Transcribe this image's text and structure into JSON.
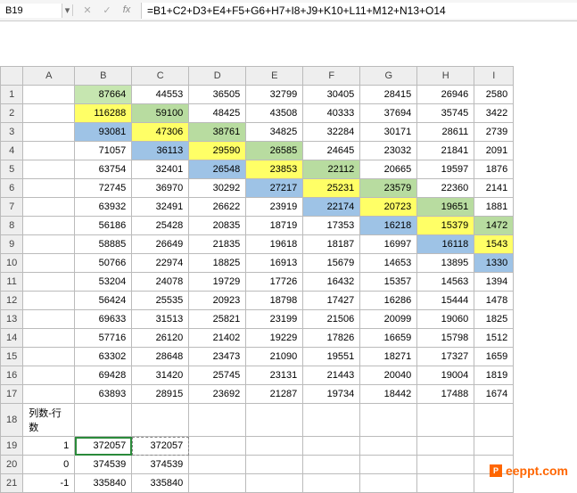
{
  "name_box": "B19",
  "formula": "=B1+C2+D3+E4+F5+G6+H7+I8+J9+K10+L11+M12+N13+O14",
  "cols": [
    "",
    "A",
    "B",
    "C",
    "D",
    "E",
    "F",
    "G",
    "H",
    "I"
  ],
  "rows": [
    {
      "r": "1",
      "cells": [
        {
          "v": ""
        },
        {
          "v": "87664",
          "c": "hl-g1"
        },
        {
          "v": "44553"
        },
        {
          "v": "36505"
        },
        {
          "v": "32799"
        },
        {
          "v": "30405"
        },
        {
          "v": "28415"
        },
        {
          "v": "26946"
        },
        {
          "v": "2580"
        }
      ]
    },
    {
      "r": "2",
      "cells": [
        {
          "v": ""
        },
        {
          "v": "116288",
          "c": "hl-y"
        },
        {
          "v": "59100",
          "c": "hl-g2"
        },
        {
          "v": "48425"
        },
        {
          "v": "43508"
        },
        {
          "v": "40333"
        },
        {
          "v": "37694"
        },
        {
          "v": "35745"
        },
        {
          "v": "3422"
        }
      ]
    },
    {
      "r": "3",
      "cells": [
        {
          "v": ""
        },
        {
          "v": "93081",
          "c": "hl-b"
        },
        {
          "v": "47306",
          "c": "hl-y"
        },
        {
          "v": "38761",
          "c": "hl-g2"
        },
        {
          "v": "34825"
        },
        {
          "v": "32284"
        },
        {
          "v": "30171"
        },
        {
          "v": "28611"
        },
        {
          "v": "2739"
        }
      ]
    },
    {
      "r": "4",
      "cells": [
        {
          "v": ""
        },
        {
          "v": "71057"
        },
        {
          "v": "36113",
          "c": "hl-b"
        },
        {
          "v": "29590",
          "c": "hl-y"
        },
        {
          "v": "26585",
          "c": "hl-g2"
        },
        {
          "v": "24645"
        },
        {
          "v": "23032"
        },
        {
          "v": "21841"
        },
        {
          "v": "2091"
        }
      ]
    },
    {
      "r": "5",
      "cells": [
        {
          "v": ""
        },
        {
          "v": "63754"
        },
        {
          "v": "32401"
        },
        {
          "v": "26548",
          "c": "hl-b"
        },
        {
          "v": "23853",
          "c": "hl-y"
        },
        {
          "v": "22112",
          "c": "hl-g2"
        },
        {
          "v": "20665"
        },
        {
          "v": "19597"
        },
        {
          "v": "1876"
        }
      ]
    },
    {
      "r": "6",
      "cells": [
        {
          "v": ""
        },
        {
          "v": "72745"
        },
        {
          "v": "36970"
        },
        {
          "v": "30292"
        },
        {
          "v": "27217",
          "c": "hl-b"
        },
        {
          "v": "25231",
          "c": "hl-y"
        },
        {
          "v": "23579",
          "c": "hl-g2"
        },
        {
          "v": "22360"
        },
        {
          "v": "2141"
        }
      ]
    },
    {
      "r": "7",
      "cells": [
        {
          "v": ""
        },
        {
          "v": "63932"
        },
        {
          "v": "32491"
        },
        {
          "v": "26622"
        },
        {
          "v": "23919"
        },
        {
          "v": "22174",
          "c": "hl-b"
        },
        {
          "v": "20723",
          "c": "hl-y"
        },
        {
          "v": "19651",
          "c": "hl-g2"
        },
        {
          "v": "1881"
        }
      ]
    },
    {
      "r": "8",
      "cells": [
        {
          "v": ""
        },
        {
          "v": "56186"
        },
        {
          "v": "25428"
        },
        {
          "v": "20835"
        },
        {
          "v": "18719"
        },
        {
          "v": "17353"
        },
        {
          "v": "16218",
          "c": "hl-b"
        },
        {
          "v": "15379",
          "c": "hl-y"
        },
        {
          "v": "1472",
          "c": "hl-g2"
        }
      ]
    },
    {
      "r": "9",
      "cells": [
        {
          "v": ""
        },
        {
          "v": "58885"
        },
        {
          "v": "26649"
        },
        {
          "v": "21835"
        },
        {
          "v": "19618"
        },
        {
          "v": "18187"
        },
        {
          "v": "16997"
        },
        {
          "v": "16118",
          "c": "hl-b"
        },
        {
          "v": "1543",
          "c": "hl-y"
        }
      ]
    },
    {
      "r": "10",
      "cells": [
        {
          "v": ""
        },
        {
          "v": "50766"
        },
        {
          "v": "22974"
        },
        {
          "v": "18825"
        },
        {
          "v": "16913"
        },
        {
          "v": "15679"
        },
        {
          "v": "14653"
        },
        {
          "v": "13895"
        },
        {
          "v": "1330",
          "c": "hl-b"
        }
      ]
    },
    {
      "r": "11",
      "cells": [
        {
          "v": ""
        },
        {
          "v": "53204"
        },
        {
          "v": "24078"
        },
        {
          "v": "19729"
        },
        {
          "v": "17726"
        },
        {
          "v": "16432"
        },
        {
          "v": "15357"
        },
        {
          "v": "14563"
        },
        {
          "v": "1394"
        }
      ]
    },
    {
      "r": "12",
      "cells": [
        {
          "v": ""
        },
        {
          "v": "56424"
        },
        {
          "v": "25535"
        },
        {
          "v": "20923"
        },
        {
          "v": "18798"
        },
        {
          "v": "17427"
        },
        {
          "v": "16286"
        },
        {
          "v": "15444"
        },
        {
          "v": "1478"
        }
      ]
    },
    {
      "r": "13",
      "cells": [
        {
          "v": ""
        },
        {
          "v": "69633"
        },
        {
          "v": "31513"
        },
        {
          "v": "25821"
        },
        {
          "v": "23199"
        },
        {
          "v": "21506"
        },
        {
          "v": "20099"
        },
        {
          "v": "19060"
        },
        {
          "v": "1825"
        }
      ]
    },
    {
      "r": "14",
      "cells": [
        {
          "v": ""
        },
        {
          "v": "57716"
        },
        {
          "v": "26120"
        },
        {
          "v": "21402"
        },
        {
          "v": "19229"
        },
        {
          "v": "17826"
        },
        {
          "v": "16659"
        },
        {
          "v": "15798"
        },
        {
          "v": "1512"
        }
      ]
    },
    {
      "r": "15",
      "cells": [
        {
          "v": ""
        },
        {
          "v": "63302"
        },
        {
          "v": "28648"
        },
        {
          "v": "23473"
        },
        {
          "v": "21090"
        },
        {
          "v": "19551"
        },
        {
          "v": "18271"
        },
        {
          "v": "17327"
        },
        {
          "v": "1659"
        }
      ]
    },
    {
      "r": "16",
      "cells": [
        {
          "v": ""
        },
        {
          "v": "69428"
        },
        {
          "v": "31420"
        },
        {
          "v": "25745"
        },
        {
          "v": "23131"
        },
        {
          "v": "21443"
        },
        {
          "v": "20040"
        },
        {
          "v": "19004"
        },
        {
          "v": "1819"
        }
      ]
    },
    {
      "r": "17",
      "cells": [
        {
          "v": ""
        },
        {
          "v": "63893"
        },
        {
          "v": "28915"
        },
        {
          "v": "23692"
        },
        {
          "v": "21287"
        },
        {
          "v": "19734"
        },
        {
          "v": "18442"
        },
        {
          "v": "17488"
        },
        {
          "v": "1674"
        }
      ]
    },
    {
      "r": "18",
      "cells": [
        {
          "v": "列数-行数",
          "a": "l"
        },
        {
          "v": ""
        },
        {
          "v": ""
        },
        {
          "v": ""
        },
        {
          "v": ""
        },
        {
          "v": ""
        },
        {
          "v": ""
        },
        {
          "v": ""
        },
        {
          "v": ""
        }
      ]
    },
    {
      "r": "19",
      "cells": [
        {
          "v": "1"
        },
        {
          "v": "372057",
          "active": true
        },
        {
          "v": "372057",
          "dashed": true
        },
        {
          "v": ""
        },
        {
          "v": ""
        },
        {
          "v": ""
        },
        {
          "v": ""
        },
        {
          "v": ""
        },
        {
          "v": ""
        }
      ]
    },
    {
      "r": "20",
      "cells": [
        {
          "v": "0"
        },
        {
          "v": "374539"
        },
        {
          "v": "374539"
        },
        {
          "v": ""
        },
        {
          "v": ""
        },
        {
          "v": ""
        },
        {
          "v": ""
        },
        {
          "v": ""
        },
        {
          "v": ""
        }
      ]
    },
    {
      "r": "21",
      "cells": [
        {
          "v": "-1"
        },
        {
          "v": "335840"
        },
        {
          "v": "335840"
        },
        {
          "v": ""
        },
        {
          "v": ""
        },
        {
          "v": ""
        },
        {
          "v": ""
        },
        {
          "v": ""
        },
        {
          "v": ""
        }
      ]
    }
  ],
  "watermark": {
    "badge": "P",
    "text": "eeppt.com"
  }
}
